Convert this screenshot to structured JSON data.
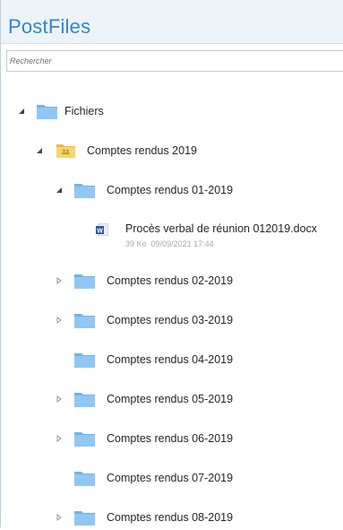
{
  "app": {
    "title": "PostFiles"
  },
  "search": {
    "placeholder": "Rechercher"
  },
  "tree": {
    "root": {
      "label": "Fichiers",
      "expanded": true
    },
    "group": {
      "label": "Comptes rendus 2019",
      "expanded": true
    },
    "folders": [
      {
        "label": "Comptes rendus 01-2019",
        "toggle": "expanded"
      },
      {
        "label": "Comptes rendus 02-2019",
        "toggle": "collapsed"
      },
      {
        "label": "Comptes rendus 03-2019",
        "toggle": "collapsed"
      },
      {
        "label": "Comptes rendus 04-2019",
        "toggle": "none"
      },
      {
        "label": "Comptes rendus 05-2019",
        "toggle": "collapsed"
      },
      {
        "label": "Comptes rendus 06-2019",
        "toggle": "collapsed"
      },
      {
        "label": "Comptes rendus 07-2019",
        "toggle": "none"
      },
      {
        "label": "Comptes rendus 08-2019",
        "toggle": "collapsed"
      }
    ],
    "file": {
      "name": "Procès verbal de réunion 012019.docx",
      "size": "39 Ko",
      "date": "09/09/2021 17:44",
      "icon": "word-document-icon"
    }
  },
  "colors": {
    "accent": "#2e88c9",
    "folder": "#8fc8f4",
    "folder_back": "#6eb3e8",
    "shared_folder": "#f6d66e",
    "word": "#2b579a"
  }
}
